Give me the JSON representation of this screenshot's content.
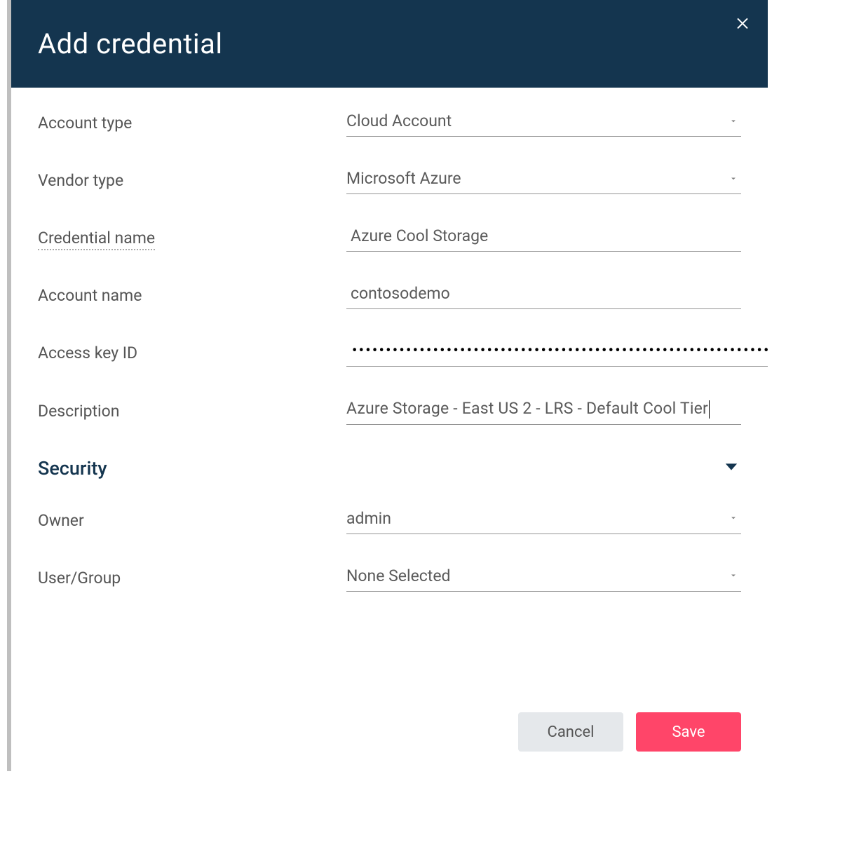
{
  "modal": {
    "title": "Add credential"
  },
  "fields": {
    "account_type": {
      "label": "Account type",
      "value": "Cloud Account"
    },
    "vendor_type": {
      "label": "Vendor type",
      "value": "Microsoft Azure"
    },
    "credential_name": {
      "label": "Credential name",
      "value": "Azure Cool Storage"
    },
    "account_name": {
      "label": "Account name",
      "value": "contosodemo"
    },
    "access_key": {
      "label": "Access key ID",
      "value": "••••••••••••••••••••••••••••••••••••••••••••••••••••••••••••••••••••••••••"
    },
    "description": {
      "label": "Description",
      "prefix": "Azure Storage - East US 2 - ",
      "spellcheck": "LRS",
      "suffix": " - Default Cool Tier"
    }
  },
  "section": {
    "security": "Security"
  },
  "security_fields": {
    "owner": {
      "label": "Owner",
      "value": "admin"
    },
    "user_group": {
      "label": "User/Group",
      "value": "None Selected"
    }
  },
  "buttons": {
    "cancel": "Cancel",
    "save": "Save"
  }
}
